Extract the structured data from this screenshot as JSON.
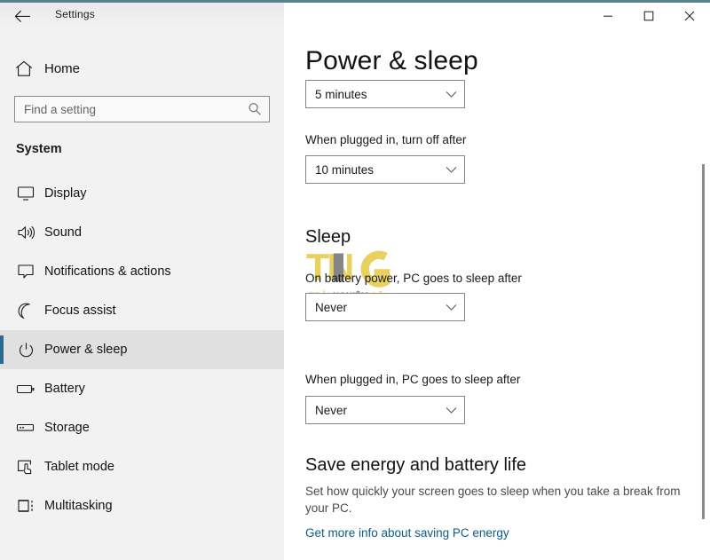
{
  "window": {
    "title": "Settings",
    "back_icon": "arrow-left-icon",
    "controls": {
      "minimize": "minimize-icon",
      "maximize": "maximize-icon",
      "close": "close-icon"
    },
    "accent_color": "#5c7f96"
  },
  "sidebar": {
    "home_label": "Home",
    "home_icon": "home-icon",
    "search": {
      "placeholder": "Find a setting",
      "value": "",
      "icon": "search-icon"
    },
    "group_title": "System",
    "selected_color": "#2b6b8f",
    "items": [
      {
        "label": "Display",
        "icon": "monitor-icon",
        "selected": false
      },
      {
        "label": "Sound",
        "icon": "speaker-icon",
        "selected": false
      },
      {
        "label": "Notifications & actions",
        "icon": "chat-bubble-icon",
        "selected": false
      },
      {
        "label": "Focus assist",
        "icon": "moon-icon",
        "selected": false
      },
      {
        "label": "Power & sleep",
        "icon": "power-icon",
        "selected": true
      },
      {
        "label": "Battery",
        "icon": "battery-icon",
        "selected": false
      },
      {
        "label": "Storage",
        "icon": "drive-icon",
        "selected": false
      },
      {
        "label": "Tablet mode",
        "icon": "tablet-touch-icon",
        "selected": false
      },
      {
        "label": "Multitasking",
        "icon": "multitasking-icon",
        "selected": false
      }
    ]
  },
  "main": {
    "page_title": "Power & sleep",
    "screen": {
      "battery_value": "5 minutes",
      "plugged_label": "When plugged in, turn off after",
      "plugged_value": "10 minutes"
    },
    "sleep": {
      "heading": "Sleep",
      "battery_label": "On battery power, PC goes to sleep after",
      "battery_value": "Never",
      "plugged_label": "When plugged in, PC goes to sleep after",
      "plugged_value": "Never"
    },
    "save_energy": {
      "heading": "Save energy and battery life",
      "description": "Set how quickly your screen goes to sleep when you take a break from your PC.",
      "link": "Get more info about saving PC energy",
      "link_color": "#0c5c8c"
    }
  },
  "watermark": {
    "logo_text": "TNS",
    "tagline_1": "TRẢI",
    "tagline_2": "NGHIỆM",
    "tagline_3": "SỐ",
    "color_yellow": "#e3c83c",
    "color_dark": "#555555"
  }
}
